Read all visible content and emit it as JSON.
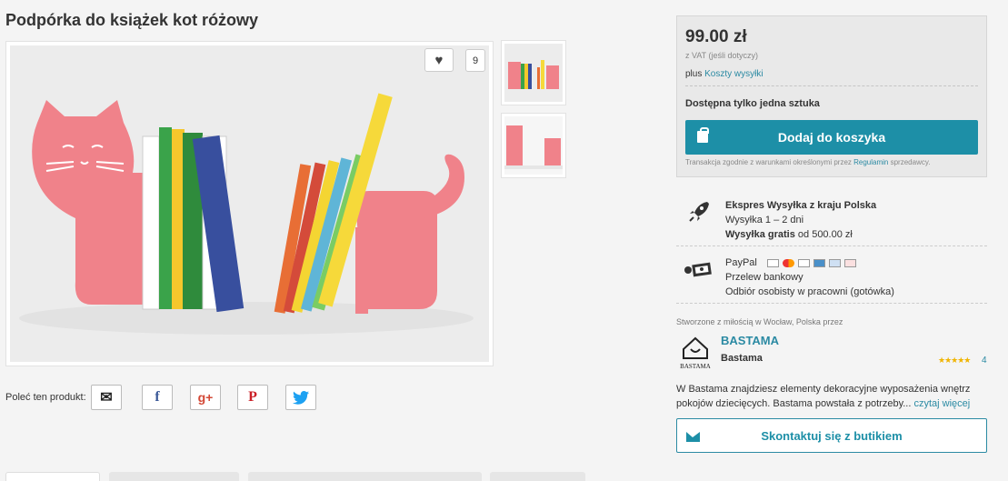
{
  "product": {
    "title": "Podpórka do książek kot różowy",
    "favorites_count": "9"
  },
  "share": {
    "label": "Poleć ten produkt:",
    "buttons": [
      {
        "name": "email",
        "glyph": "✉",
        "color": "#222"
      },
      {
        "name": "facebook",
        "glyph": "f",
        "color": "#3b5998"
      },
      {
        "name": "google-plus",
        "glyph": "g+",
        "color": "#d34836"
      },
      {
        "name": "pinterest",
        "glyph": "P",
        "color": "#cb2027"
      },
      {
        "name": "twitter",
        "glyph": "🐦",
        "color": "#1da1f2"
      }
    ]
  },
  "buy": {
    "price": "99.00 zł",
    "vat_note": "z VAT (jeśli dotyczy)",
    "shipping_prefix": "plus",
    "shipping_link": "Koszty wysyłki",
    "availability": "Dostępna tylko jedna sztuka",
    "add_to_cart": "Dodaj do koszyka",
    "terms_prefix": "Transakcja zgodnie z warunkami określonymi przez",
    "terms_link": "Regulamin",
    "terms_suffix": "sprzedawcy."
  },
  "shipping": {
    "title": "Ekspres Wysyłka z kraju Polska",
    "time": "Wysyłka 1 – 2 dni",
    "free_label": "Wysyłka gratis",
    "free_suffix": "od 500.00 zł"
  },
  "payment": {
    "paypal": "PayPal",
    "transfer": "Przelew bankowy",
    "pickup": "Odbiór osobisty w pracowni (gotówka)"
  },
  "shop": {
    "created_text": "Stworzone z miłością w Wocław, Polska przez",
    "name_link": "BASTAMA",
    "name": "Bastama",
    "logo_text": "BASTAMA",
    "rating_stars": "★★★★★",
    "rating_count": "4",
    "about": "W Bastama znajdziesz elementy dekoracyjne wyposażenia wnętrz pokojów dziecięcych. Bastama powstała z potrzeby...",
    "read_more": "czytaj więcej",
    "contact": "Skontaktuj się z butikiem"
  },
  "colors": {
    "accent": "#1d8fa7",
    "cat_pink": "#f0828a"
  }
}
